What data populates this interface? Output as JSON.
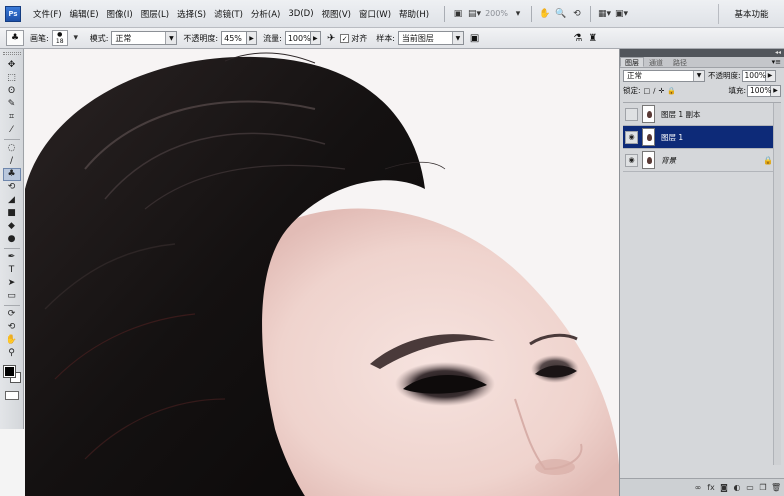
{
  "app": {
    "logo": "Ps",
    "menu": [
      "文件(F)",
      "编辑(E)",
      "图像(I)",
      "图层(L)",
      "选择(S)",
      "滤镜(T)",
      "分析(A)",
      "3D(D)",
      "视图(V)",
      "窗口(W)",
      "帮助(H)"
    ],
    "zoom": "200%",
    "workspace": "基本功能"
  },
  "options": {
    "brush_label": "画笔:",
    "brush_size": "18",
    "mode_label": "模式:",
    "mode_value": "正常",
    "opacity_label": "不透明度:",
    "opacity_value": "45%",
    "flow_label": "流量:",
    "flow_value": "100%",
    "aligned_label": "对齐",
    "sample_label": "样本:",
    "sample_value": "当前图层"
  },
  "layers_panel": {
    "tabs": [
      "图层",
      "通道",
      "路径"
    ],
    "blend_mode": "正常",
    "opacity_label": "不透明度:",
    "opacity_value": "100%",
    "lock_label": "锁定:",
    "fill_label": "填充:",
    "fill_value": "100%",
    "layers": [
      {
        "name": "图层 1 副本",
        "visible": false,
        "selected": false,
        "locked": false
      },
      {
        "name": "图层 1",
        "visible": true,
        "selected": true,
        "locked": false
      },
      {
        "name": "背景",
        "visible": true,
        "selected": false,
        "locked": true
      }
    ]
  },
  "icons": {
    "eye": "eye-icon",
    "lock": "lock-icon",
    "toolbox": [
      "move-icon",
      "marquee-icon",
      "lasso-icon",
      "quick-select-icon",
      "crop-icon",
      "eyedropper-icon",
      "healing-icon",
      "brush-icon",
      "clone-stamp-icon",
      "history-brush-icon",
      "eraser-icon",
      "gradient-icon",
      "blur-icon",
      "dodge-icon",
      "pen-icon",
      "type-icon",
      "path-select-icon",
      "shape-icon",
      "3d-rotate-icon",
      "3d-orbit-icon",
      "hand-icon",
      "zoom-icon"
    ]
  },
  "colors": {
    "selected_layer": "#0d2a78",
    "foreground": "#000000",
    "background": "#ffffff"
  }
}
